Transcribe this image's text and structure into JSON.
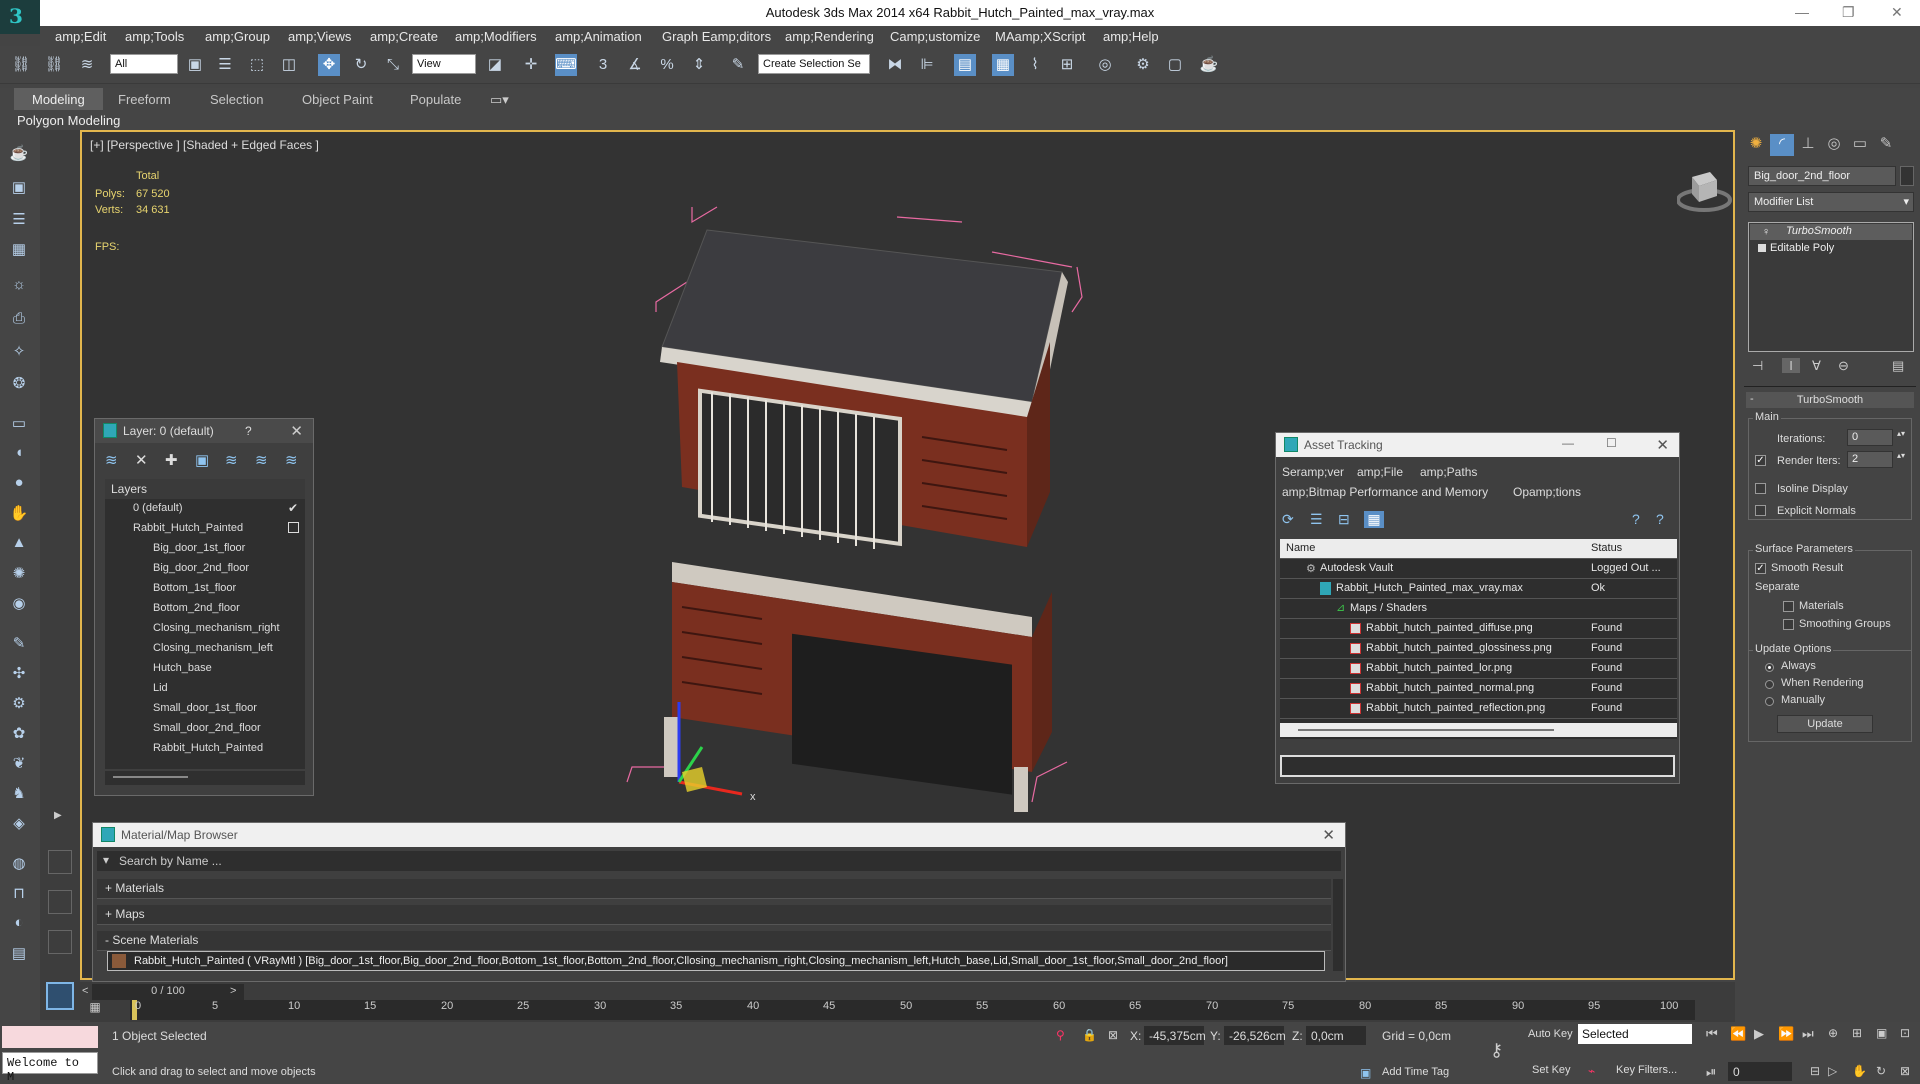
{
  "app": {
    "title": "Autodesk 3ds Max  2014 x64     Rabbit_Hutch_Painted_max_vray.max",
    "logo": "3"
  },
  "window_controls": {
    "minimize": "—",
    "restore": "❐",
    "close": "✕"
  },
  "menu": [
    "amp;Edit",
    "amp;Tools",
    "amp;Group",
    "amp;Views",
    "amp;Create",
    "amp;Modifiers",
    "amp;Animation",
    "Graph Eamp;ditors",
    "amp;Rendering",
    "Camp;ustomize",
    "MAamp;XScript",
    "amp;Help"
  ],
  "toolbar": {
    "selection_filter": "All",
    "ref_coord": "View",
    "named_selection": "Create Selection Se"
  },
  "ribbon": {
    "tabs": [
      "Modeling",
      "Freeform",
      "Selection",
      "Object Paint",
      "Populate"
    ],
    "sub": "Polygon Modeling"
  },
  "viewport": {
    "label": "[+] [Perspective ] [Shaded + Edged Faces ]",
    "stats": {
      "total_label": "Total",
      "polys_label": "Polys:",
      "polys": "67 520",
      "verts_label": "Verts:",
      "verts": "34 631",
      "fps_label": "FPS:"
    },
    "gizmo_axis": "x"
  },
  "layer_panel": {
    "title": "Layer: 0 (default)",
    "help": "?",
    "header": "Layers",
    "items": [
      {
        "label": "0 (default)",
        "indent": 0
      },
      {
        "label": "Rabbit_Hutch_Painted",
        "indent": 0
      },
      {
        "label": "Big_door_1st_floor",
        "indent": 1
      },
      {
        "label": "Big_door_2nd_floor",
        "indent": 1
      },
      {
        "label": "Bottom_1st_floor",
        "indent": 1
      },
      {
        "label": "Bottom_2nd_floor",
        "indent": 1
      },
      {
        "label": "Closing_mechanism_right",
        "indent": 1
      },
      {
        "label": "Closing_mechanism_left",
        "indent": 1
      },
      {
        "label": "Hutch_base",
        "indent": 1
      },
      {
        "label": "Lid",
        "indent": 1
      },
      {
        "label": "Small_door_1st_floor",
        "indent": 1
      },
      {
        "label": "Small_door_2nd_floor",
        "indent": 1
      },
      {
        "label": "Rabbit_Hutch_Painted",
        "indent": 1
      }
    ]
  },
  "asset_tracking": {
    "title": "Asset Tracking",
    "menu": [
      "Seramp;ver",
      "amp;File",
      "amp;Paths"
    ],
    "menu2": [
      "amp;Bitmap Performance and Memory",
      "Opamp;tions"
    ],
    "col_name": "Name",
    "col_status": "Status",
    "rows": [
      {
        "name": "Autodesk Vault",
        "status": "Logged Out ...",
        "indent": 1
      },
      {
        "name": "Rabbit_Hutch_Painted_max_vray.max",
        "status": "Ok",
        "indent": 2
      },
      {
        "name": "Maps / Shaders",
        "status": "",
        "indent": 3
      },
      {
        "name": "Rabbit_hutch_painted_diffuse.png",
        "status": "Found",
        "indent": 4
      },
      {
        "name": "Rabbit_hutch_painted_glossiness.png",
        "status": "Found",
        "indent": 4
      },
      {
        "name": "Rabbit_hutch_painted_lor.png",
        "status": "Found",
        "indent": 4
      },
      {
        "name": "Rabbit_hutch_painted_normal.png",
        "status": "Found",
        "indent": 4
      },
      {
        "name": "Rabbit_hutch_painted_reflection.png",
        "status": "Found",
        "indent": 4
      }
    ]
  },
  "material_browser": {
    "title": "Material/Map Browser",
    "search_placeholder": "Search by Name ...",
    "sections": [
      "+ Materials",
      "+ Maps",
      "- Scene Materials"
    ],
    "scene_material": "Rabbit_Hutch_Painted ( VRayMtl ) [Big_door_1st_floor,Big_door_2nd_floor,Bottom_1st_floor,Bottom_2nd_floor,Cllosing_mechanism_right,Closing_mechanism_left,Hutch_base,Lid,Small_door_1st_floor,Small_door_2nd_floor]"
  },
  "command_panel": {
    "object_name": "Big_door_2nd_floor",
    "modifier_list": "Modifier List",
    "stack": [
      "TurboSmooth",
      "Editable Poly"
    ],
    "rollout_title": "TurboSmooth",
    "main_label": "Main",
    "iterations_label": "Iterations:",
    "iterations": "0",
    "render_iters_label": "Render Iters:",
    "render_iters": "2",
    "render_iters_checked": true,
    "isoline_label": "Isoline Display",
    "explicit_label": "Explicit Normals",
    "surface_label": "Surface Parameters",
    "smooth_label": "Smooth Result",
    "smooth_checked": true,
    "separate_label": "Separate",
    "materials_label": "Materials",
    "smoothing_label": "Smoothing Groups",
    "update_label": "Update Options",
    "always_label": "Always",
    "when_rendering_label": "When Rendering",
    "manually_label": "Manually",
    "update_button": "Update"
  },
  "timeline": {
    "frame": "0 / 100",
    "ticks": [
      "0",
      "5",
      "10",
      "15",
      "20",
      "25",
      "30",
      "35",
      "40",
      "45",
      "50",
      "55",
      "60",
      "65",
      "70",
      "75",
      "80",
      "85",
      "90",
      "95",
      "100"
    ]
  },
  "status": {
    "script_listener": "Welcome to M",
    "selected": "1 Object Selected",
    "prompt": "Click and drag to select and move objects",
    "x_label": "X:",
    "x": "-45,375cm",
    "y_label": "Y:",
    "y": "-26,526cm",
    "z_label": "Z:",
    "z": "0,0cm",
    "grid": "Grid = 0,0cm",
    "add_time_tag": "Add Time Tag",
    "auto_key": "Auto Key",
    "set_key": "Set Key",
    "key_mode": "Selected",
    "key_filters": "Key Filters...",
    "frame_field": "0"
  }
}
